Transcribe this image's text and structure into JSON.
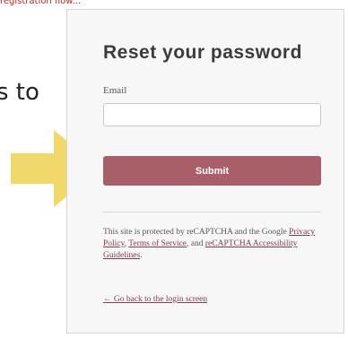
{
  "background": {
    "top_text": "registration flow...",
    "partial_text": "s to",
    "arrow_color": "#f0d86a"
  },
  "card": {
    "title": "Reset your password",
    "email_label": "Email",
    "email_value": "",
    "email_placeholder": "",
    "submit_label": "Submit",
    "recaptcha_prefix": "This site is protected by reCAPTCHA and the Google ",
    "privacy_policy": "Privacy Policy",
    "comma": ", ",
    "terms_of_service": "Terms of Service",
    "and_text": ", and ",
    "recaptcha_accessibility": "reCAPTCHA Accessibility Guidelines",
    "period": ".",
    "back_link": "← Go back to the login screen"
  },
  "colors": {
    "accent": "#a95f6a",
    "link": "#7a3d49"
  }
}
